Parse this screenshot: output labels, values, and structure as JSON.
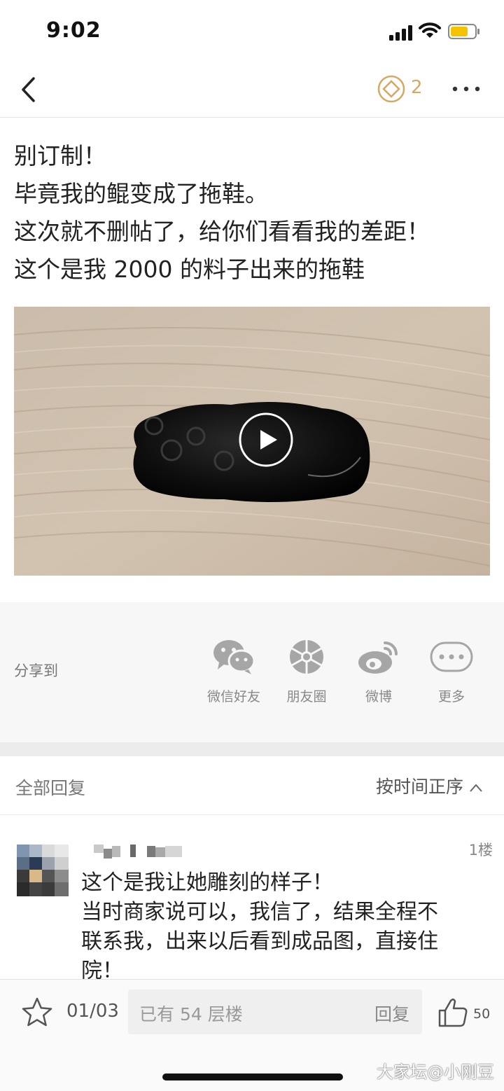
{
  "status_bar": {
    "time": "9:02"
  },
  "nav": {
    "coin_count": "2"
  },
  "post": {
    "lines": [
      "别订制！",
      "毕竟我的鲲变成了拖鞋。",
      "这次就不删帖了，给你们看看我的差距！",
      "这个是我 2000 的料子出来的拖鞋"
    ]
  },
  "share": {
    "label": "分享到",
    "items": [
      {
        "label": "微信好友",
        "icon": "wechat-icon"
      },
      {
        "label": "朋友圈",
        "icon": "moments-icon"
      },
      {
        "label": "微博",
        "icon": "weibo-icon"
      },
      {
        "label": "更多",
        "icon": "more-icon"
      }
    ]
  },
  "replies": {
    "title": "全部回复",
    "sort_label": "按时间正序",
    "items": [
      {
        "floor": "1楼",
        "lines": [
          "这个是我让她雕刻的样子！",
          "当时商家说可以，我信了，结果全程不",
          "联系我，出来以后看到成品图，直接住",
          "院！"
        ]
      }
    ]
  },
  "bottom_bar": {
    "page_indicator": "01/03",
    "reply_placeholder": "已有 54 层楼",
    "reply_button": "回复",
    "like_count": "50"
  },
  "watermark": "大家坛@小刚豆",
  "colors": {
    "accent_gold": "#d4a865",
    "icon_gray": "#a6a6a6"
  }
}
